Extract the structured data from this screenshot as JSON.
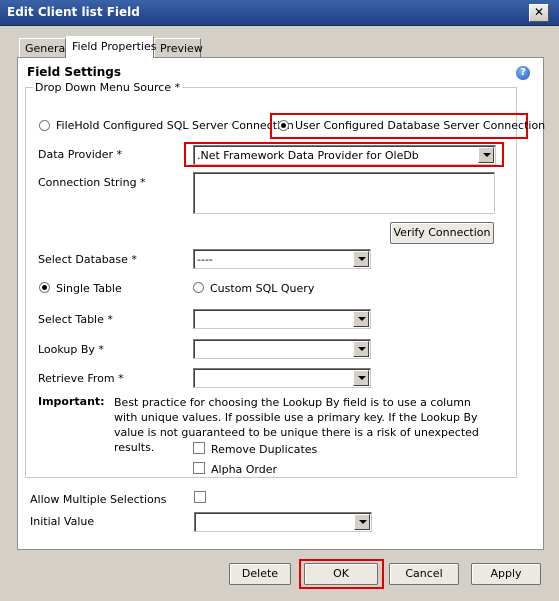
{
  "window": {
    "title": "Edit Client list Field",
    "close_label": "✕"
  },
  "tabs": [
    {
      "label": "General"
    },
    {
      "label": "Field Properties"
    },
    {
      "label": "Preview"
    }
  ],
  "section": {
    "title": "Field Settings",
    "help_label": "?"
  },
  "group": {
    "legend": "Drop Down Menu Source *"
  },
  "source": {
    "filehold_label": "FileHold Configured SQL Server Connection",
    "user_label": "User Configured Database Server Connection"
  },
  "form": {
    "data_provider_label": "Data Provider *",
    "data_provider_value": ".Net Framework Data Provider for OleDb",
    "connection_string_label": "Connection String *",
    "connection_string_value": "",
    "verify_label": "Verify Connection",
    "select_database_label": "Select Database *",
    "select_database_value": "----",
    "single_table_label": "Single Table",
    "custom_sql_label": "Custom SQL Query",
    "select_table_label": "Select Table *",
    "select_table_value": "",
    "lookup_by_label": "Lookup By *",
    "lookup_by_value": "",
    "retrieve_from_label": "Retrieve From *",
    "retrieve_from_value": "",
    "important_label": "Important:",
    "important_text": "Best practice for choosing the Lookup By field is to use a column with unique values. If possible use a primary key. If the Lookup By value is not guaranteed to be unique there is a risk of unexpected results.",
    "remove_duplicates_label": "Remove Duplicates",
    "alpha_order_label": "Alpha Order",
    "allow_multiple_label": "Allow Multiple Selections",
    "initial_value_label": "Initial Value",
    "initial_value_value": ""
  },
  "buttons": {
    "delete": "Delete",
    "ok": "OK",
    "cancel": "Cancel",
    "apply": "Apply"
  },
  "colors": {
    "highlight": "#e00000",
    "titlebar": "#2a4f99"
  }
}
